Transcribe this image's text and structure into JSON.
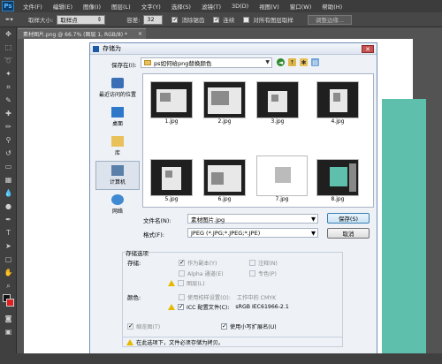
{
  "app": {
    "logo": "Ps"
  },
  "menu": [
    "文件(F)",
    "编辑(E)",
    "图像(I)",
    "图层(L)",
    "文字(Y)",
    "选择(S)",
    "滤镜(T)",
    "3D(D)",
    "视图(V)",
    "窗口(W)",
    "帮助(H)"
  ],
  "options": {
    "sample_size_label": "取样大小:",
    "sample_size_value": "取样点",
    "tolerance_label": "容差:",
    "tolerance_value": "32",
    "antialias": "消除锯齿",
    "contiguous": "连续",
    "all_layers": "对所有图层取样",
    "refine_edge": "调整边缘..."
  },
  "document_tab": "素材图片.png @ 66.7% (图层 1, RGB/8) *",
  "dialog": {
    "title": "存储为",
    "save_in_label": "保存在(I):",
    "save_in_value": "ps如何给png替换颜色",
    "places": [
      {
        "label": "最近访问的位置",
        "icon": "recent-icon"
      },
      {
        "label": "桌面",
        "icon": "desktop-icon"
      },
      {
        "label": "库",
        "icon": "library-icon"
      },
      {
        "label": "计算机",
        "icon": "computer-icon"
      },
      {
        "label": "网络",
        "icon": "network-icon"
      }
    ],
    "files": [
      "1.jpg",
      "2.jpg",
      "3.jpg",
      "4.jpg",
      "5.jpg",
      "6.jpg",
      "7.jpg",
      "8.jpg"
    ],
    "filename_label": "文件名(N):",
    "filename_value": "素材图片.jpg",
    "format_label": "格式(F):",
    "format_value": "JPEG (*.JPG;*.JPEG;*.JPE)",
    "save_button": "保存(S)",
    "cancel_button": "取消",
    "save_options_title": "存储选项",
    "save_label": "存储:",
    "as_copy": "作为副本(Y)",
    "notes": "注释(N)",
    "alpha": "Alpha 通道(E)",
    "spot_colors": "专色(P)",
    "layers": "图层(L)",
    "color_label": "颜色:",
    "use_proof": "使用校样设置(O):",
    "proof_value": "工作中的 CMYK",
    "icc_label": "ICC 配置文件(C):",
    "icc_value": "sRGB IEC61966-2.1",
    "thumbnail": "缩览图(T)",
    "lowercase_ext": "使用小写扩展名(U)",
    "warning": "在此选项下，文件必须存储为拷贝。"
  },
  "colors": {
    "accent": "#5fbfad",
    "ps_blue": "#0b3d66"
  }
}
